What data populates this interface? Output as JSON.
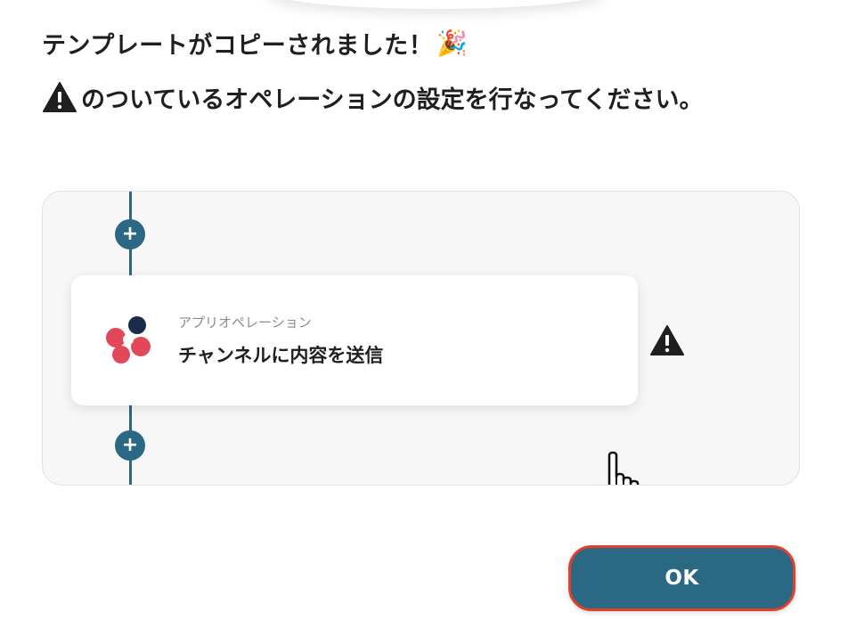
{
  "header": {
    "copied_message": "テンプレートがコピーされました！",
    "party_emoji": "🎉",
    "instruction": "のついているオペレーションの設定を行なってください。"
  },
  "flow": {
    "operation": {
      "type_label": "アプリオペレーション",
      "name": "チャンネルに内容を送信",
      "has_warning": true
    },
    "add_button_icon": "plus-icon",
    "connector_color": "#2a6883"
  },
  "footer": {
    "ok_label": "OK"
  },
  "colors": {
    "accent": "#2a6883",
    "highlight_border": "#e2402d",
    "logo_red": "#e3485a",
    "logo_dark": "#1c2b4a"
  }
}
